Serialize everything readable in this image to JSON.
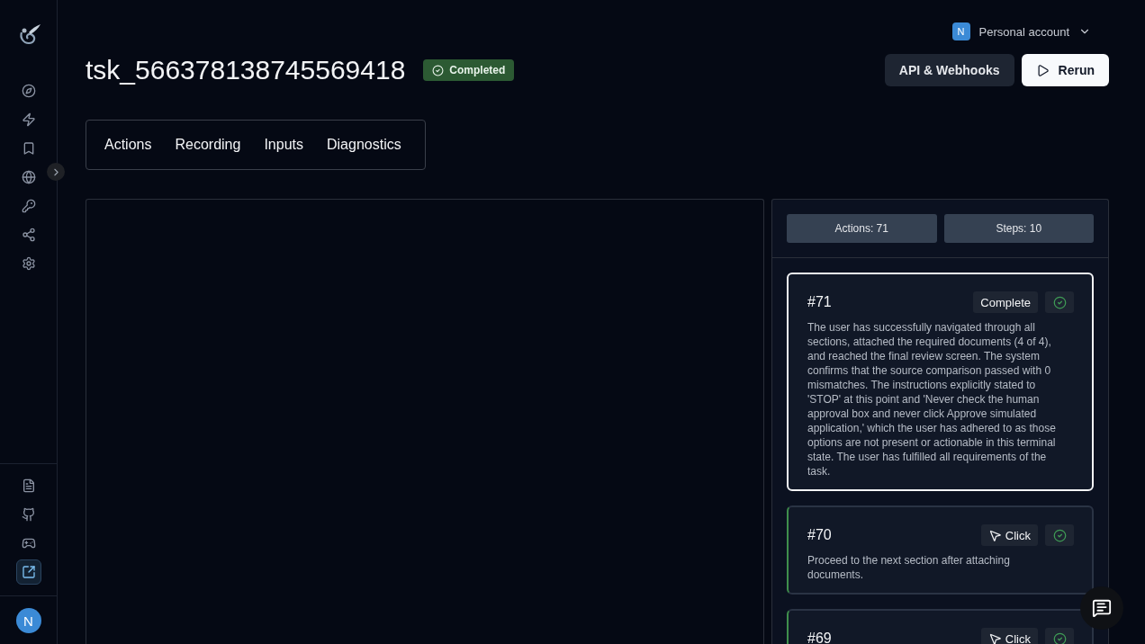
{
  "sidebar": {
    "nav_items": [
      {
        "selected": false
      },
      {
        "selected": false
      },
      {
        "selected": false
      },
      {
        "selected": false
      },
      {
        "selected": false
      },
      {
        "selected": false
      },
      {
        "selected": false
      }
    ],
    "footer_items": [
      {
        "selected": false
      },
      {
        "selected": false
      },
      {
        "selected": false
      },
      {
        "selected": true
      }
    ],
    "avatar": "N"
  },
  "account": {
    "avatar": "N",
    "label": "Personal account"
  },
  "task": {
    "title": "tsk_566378138745569418",
    "status": "Completed"
  },
  "header_buttons": [
    {
      "label": "API & Webhooks",
      "kind": "secondary"
    },
    {
      "label": "Rerun",
      "kind": "primary"
    }
  ],
  "tabs": [
    {
      "label": "Actions",
      "selected": false
    },
    {
      "label": "Recording",
      "selected": false
    },
    {
      "label": "Inputs",
      "selected": false
    },
    {
      "label": "Diagnostics",
      "selected": false
    }
  ],
  "stats": [
    "Actions: 71",
    "Steps: 10"
  ],
  "actions": [
    {
      "number": "#71",
      "kind": "complete",
      "label": "Complete",
      "success": true,
      "selected": true,
      "description": "The user has successfully navigated through all sections, attached the required documents (4 of 4), and reached the final review screen. The system confirms that the source comparison passed with 0 mismatches. The instructions explicitly stated to 'STOP' at this point and 'Never check the human approval box and never click Approve simulated application,' which the user has adhered to as those options are not present or actionable in this terminal state. The user has fulfilled all requirements of the task."
    },
    {
      "number": "#70",
      "kind": "click",
      "label": "Click",
      "success": true,
      "selected": false,
      "description": "Proceed to the next section after attaching documents."
    },
    {
      "number": "#69",
      "kind": "click",
      "label": "Click",
      "success": true,
      "selected": false
    }
  ]
}
